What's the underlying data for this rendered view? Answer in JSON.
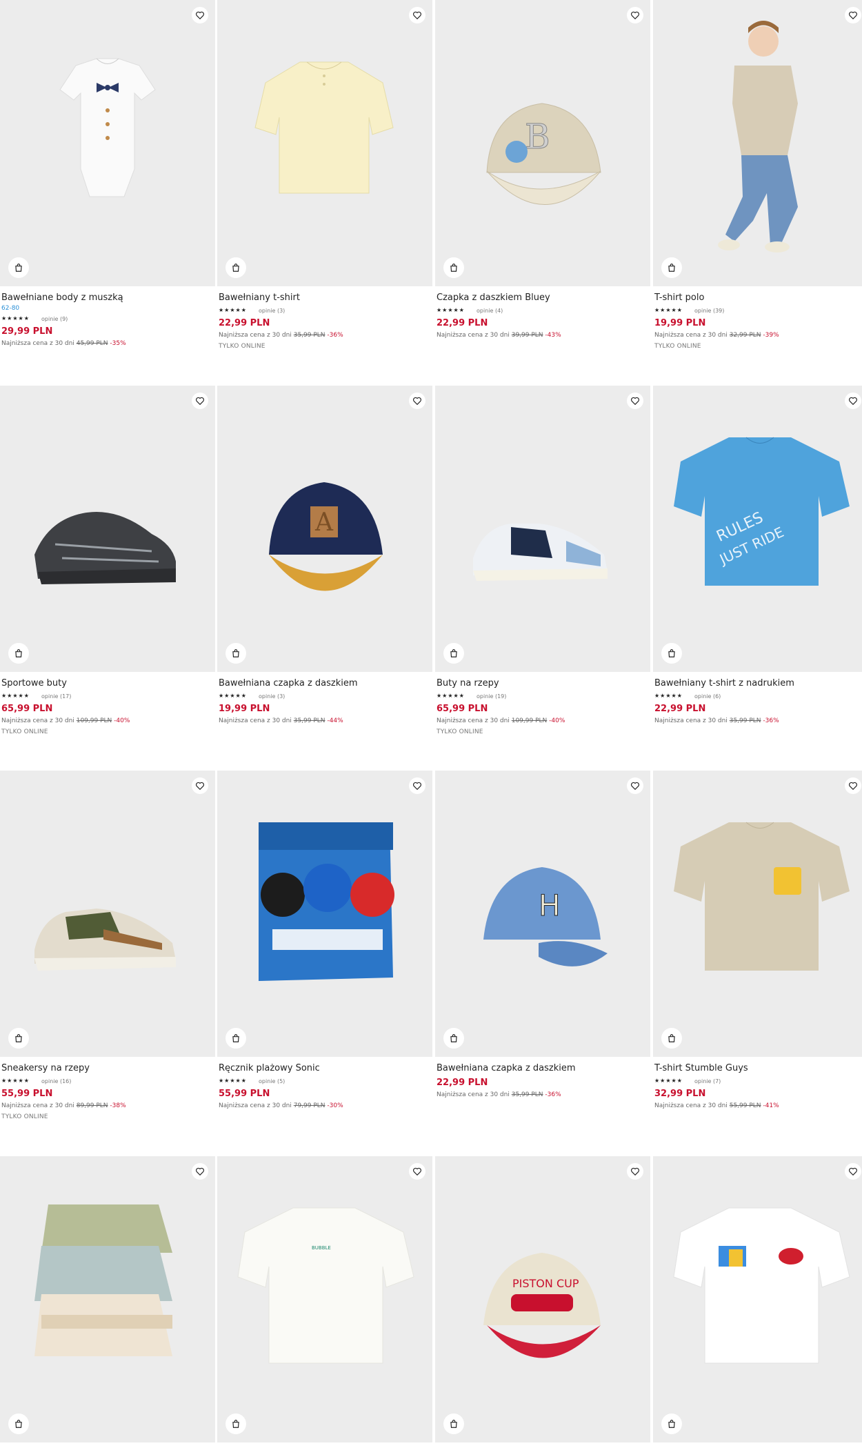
{
  "labels": {
    "lowest_prefix": "Najniższa cena z 30 dni",
    "online_only": "TYLKO ONLINE"
  },
  "products": [
    {
      "name": "Bawełniane body z muszką",
      "sizes": "62-80",
      "rating": 5,
      "reviews": "opinie (9)",
      "price": "29,99 PLN",
      "old_price": "45,99 PLN",
      "discount": "-35%",
      "online": false,
      "art": "bodysuit"
    },
    {
      "name": "Bawełniany t-shirt",
      "rating": 5,
      "reviews": "opinie (3)",
      "price": "22,99 PLN",
      "old_price": "35,99 PLN",
      "discount": "-36%",
      "online": true,
      "art": "tshirt-yellow"
    },
    {
      "name": "Czapka z daszkiem Bluey",
      "rating": 5,
      "reviews": "opinie (4)",
      "price": "22,99 PLN",
      "old_price": "39,99 PLN",
      "discount": "-43%",
      "online": false,
      "art": "cap-beige"
    },
    {
      "name": "T-shirt polo",
      "rating": 5,
      "reviews": "opinie (39)",
      "price": "19,99 PLN",
      "old_price": "32,99 PLN",
      "discount": "-39%",
      "online": true,
      "art": "boy-polo"
    },
    {
      "name": "Sportowe buty",
      "rating": 4.5,
      "reviews": "opinie (17)",
      "price": "65,99 PLN",
      "old_price": "109,99 PLN",
      "discount": "-40%",
      "online": true,
      "art": "shoe-black"
    },
    {
      "name": "Bawełniana czapka z daszkiem",
      "rating": 4.5,
      "reviews": "opinie (3)",
      "price": "19,99 PLN",
      "old_price": "35,99 PLN",
      "discount": "-44%",
      "online": false,
      "art": "cap-navy"
    },
    {
      "name": "Buty na rzepy",
      "rating": 4.5,
      "reviews": "opinie (19)",
      "price": "65,99 PLN",
      "old_price": "109,99 PLN",
      "discount": "-40%",
      "online": true,
      "art": "shoe-navy"
    },
    {
      "name": "Bawełniany t-shirt z nadrukiem",
      "rating": 5,
      "reviews": "opinie (6)",
      "price": "22,99 PLN",
      "old_price": "35,99 PLN",
      "discount": "-36%",
      "online": false,
      "art": "tshirt-blue"
    },
    {
      "name": "Sneakersy na rzepy",
      "rating": 4.5,
      "reviews": "opinie (16)",
      "price": "55,99 PLN",
      "old_price": "89,99 PLN",
      "discount": "-38%",
      "online": true,
      "art": "shoe-beige"
    },
    {
      "name": "Ręcznik plażowy Sonic",
      "rating": 5,
      "reviews": "opinie (5)",
      "price": "55,99 PLN",
      "old_price": "79,99 PLN",
      "discount": "-30%",
      "online": false,
      "art": "towel"
    },
    {
      "name": "Bawełniana czapka z daszkiem",
      "price": "22,99 PLN",
      "old_price": "35,99 PLN",
      "discount": "-36%",
      "online": false,
      "art": "cap-blue"
    },
    {
      "name": "T-shirt Stumble Guys",
      "rating": 5,
      "reviews": "opinie (7)",
      "price": "32,99 PLN",
      "old_price": "55,99 PLN",
      "discount": "-41%",
      "online": false,
      "art": "tshirt-beige"
    },
    {
      "name": "",
      "art": "tshirts-stack"
    },
    {
      "name": "",
      "art": "tshirt-white-bubble"
    },
    {
      "name": "",
      "art": "cap-piston"
    },
    {
      "name": "",
      "art": "tshirt-uno"
    }
  ]
}
